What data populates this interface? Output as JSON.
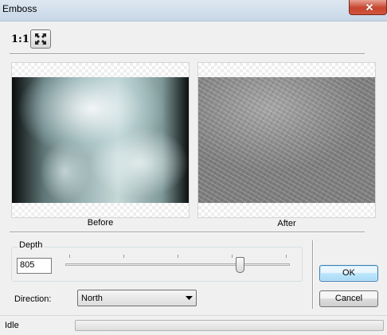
{
  "window": {
    "title": "Emboss"
  },
  "toolbar": {
    "zoom_label": "1:1",
    "fit_icon": "fit-to-window-icon"
  },
  "previews": {
    "before_label": "Before",
    "after_label": "After"
  },
  "depth": {
    "group_label": "Depth",
    "value": "805",
    "slider_fraction": 0.78
  },
  "direction": {
    "label": "Direction:",
    "selected": "North"
  },
  "buttons": {
    "ok": "OK",
    "cancel": "Cancel"
  },
  "status": {
    "text": "Idle",
    "progress_fraction": 0
  },
  "colors": {
    "ok_border": "#3c7fb1",
    "close_button": "#c7452e"
  }
}
